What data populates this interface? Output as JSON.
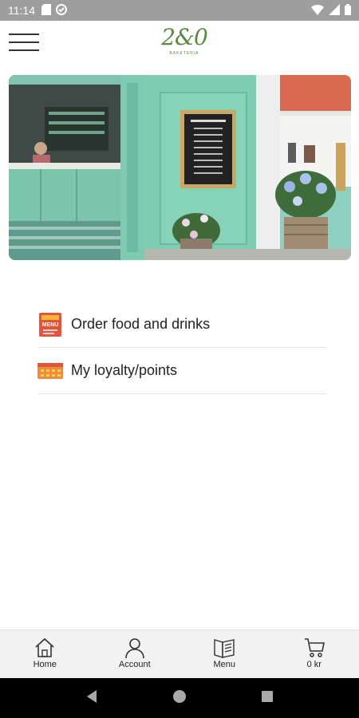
{
  "status_bar": {
    "time": "11:14"
  },
  "header": {
    "logo_text": "2&0",
    "logo_subtitle": "BAKETERIA"
  },
  "colors": {
    "accent_green": "#5a8a3e",
    "status_bar": "#9e9e9e",
    "menu_icon_red": "#e2543c",
    "menu_icon_orange": "#f08a3c"
  },
  "menu_items": [
    {
      "label": "Order food and drinks",
      "icon": "menu-board-icon",
      "icon_text": "MENU"
    },
    {
      "label": "My loyalty/points",
      "icon": "loyalty-card-icon"
    }
  ],
  "bottom_nav": [
    {
      "label": "Home",
      "icon": "home-icon"
    },
    {
      "label": "Account",
      "icon": "account-icon"
    },
    {
      "label": "Menu",
      "icon": "menu-book-icon"
    },
    {
      "label": "0 kr",
      "icon": "cart-icon"
    }
  ]
}
